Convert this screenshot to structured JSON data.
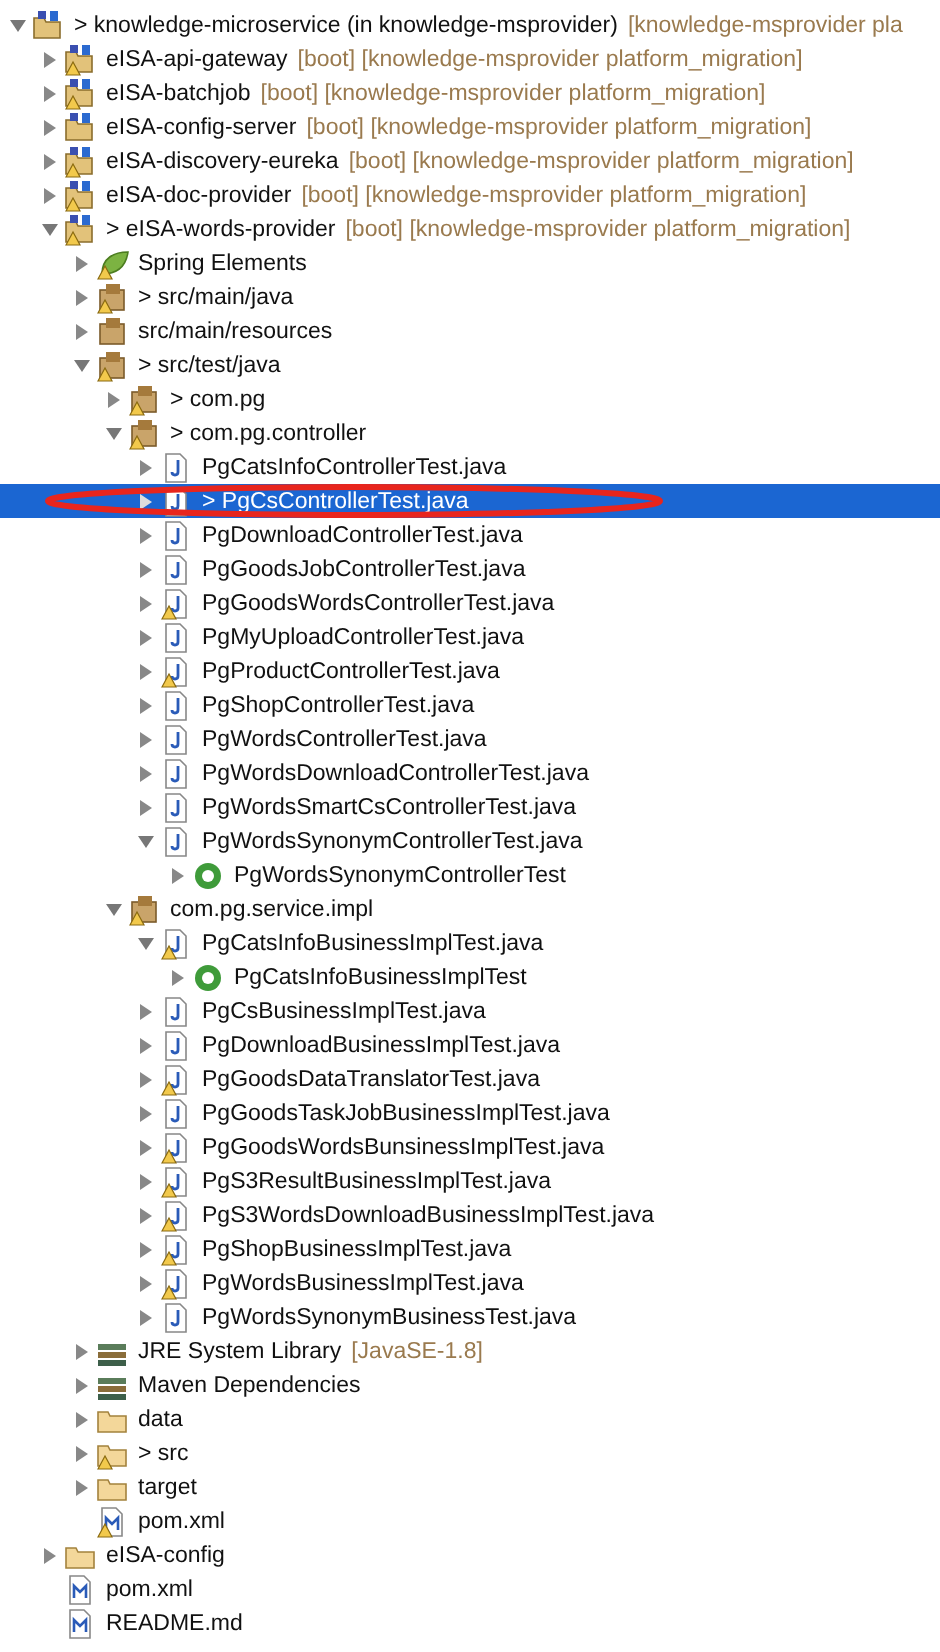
{
  "tree": [
    {
      "label": "> knowledge-microservice (in knowledge-msprovider)",
      "suffix": "[knowledge-msprovider pla",
      "kind": "working-set",
      "warning": false,
      "expandable": true,
      "expanded": true,
      "selected": false,
      "children": [
        {
          "label": "eISA-api-gateway",
          "suffix": "[boot]  [knowledge-msprovider platform_migration]",
          "kind": "project",
          "warning": true,
          "expandable": true,
          "expanded": false,
          "selected": false
        },
        {
          "label": "eISA-batchjob",
          "suffix": "[boot]  [knowledge-msprovider platform_migration]",
          "kind": "project",
          "warning": true,
          "expandable": true,
          "expanded": false,
          "selected": false
        },
        {
          "label": "eISA-config-server",
          "suffix": "[boot]  [knowledge-msprovider platform_migration]",
          "kind": "project",
          "warning": false,
          "expandable": true,
          "expanded": false,
          "selected": false
        },
        {
          "label": "eISA-discovery-eureka",
          "suffix": "[boot]  [knowledge-msprovider platform_migration]",
          "kind": "project",
          "warning": true,
          "expandable": true,
          "expanded": false,
          "selected": false
        },
        {
          "label": "eISA-doc-provider",
          "suffix": "[boot]  [knowledge-msprovider platform_migration]",
          "kind": "project",
          "warning": true,
          "expandable": true,
          "expanded": false,
          "selected": false
        },
        {
          "label": "> eISA-words-provider",
          "suffix": "[boot]  [knowledge-msprovider platform_migration]",
          "kind": "project",
          "warning": true,
          "expandable": true,
          "expanded": true,
          "selected": false,
          "children": [
            {
              "label": "Spring Elements",
              "kind": "spring",
              "warning": true,
              "expandable": true,
              "expanded": false,
              "selected": false
            },
            {
              "label": "> src/main/java",
              "kind": "source",
              "warning": true,
              "expandable": true,
              "expanded": false,
              "selected": false
            },
            {
              "label": "src/main/resources",
              "kind": "source",
              "warning": false,
              "expandable": true,
              "expanded": false,
              "selected": false
            },
            {
              "label": "> src/test/java",
              "kind": "source",
              "warning": true,
              "expandable": true,
              "expanded": true,
              "selected": false,
              "children": [
                {
                  "label": "> com.pg",
                  "kind": "package",
                  "warning": true,
                  "expandable": true,
                  "expanded": false,
                  "selected": false
                },
                {
                  "label": "> com.pg.controller",
                  "kind": "package",
                  "warning": true,
                  "expandable": true,
                  "expanded": true,
                  "selected": false,
                  "children": [
                    {
                      "label": "PgCatsInfoControllerTest.java",
                      "kind": "java",
                      "warning": false,
                      "expandable": true,
                      "expanded": false,
                      "selected": false
                    },
                    {
                      "label": "> PgCsControllerTest.java",
                      "kind": "java",
                      "warning": false,
                      "expandable": true,
                      "expanded": false,
                      "selected": true
                    },
                    {
                      "label": "PgDownloadControllerTest.java",
                      "kind": "java",
                      "warning": false,
                      "expandable": true,
                      "expanded": false,
                      "selected": false
                    },
                    {
                      "label": "PgGoodsJobControllerTest.java",
                      "kind": "java",
                      "warning": false,
                      "expandable": true,
                      "expanded": false,
                      "selected": false
                    },
                    {
                      "label": "PgGoodsWordsControllerTest.java",
                      "kind": "java",
                      "warning": true,
                      "expandable": true,
                      "expanded": false,
                      "selected": false
                    },
                    {
                      "label": "PgMyUploadControllerTest.java",
                      "kind": "java",
                      "warning": false,
                      "expandable": true,
                      "expanded": false,
                      "selected": false
                    },
                    {
                      "label": "PgProductControllerTest.java",
                      "kind": "java",
                      "warning": true,
                      "expandable": true,
                      "expanded": false,
                      "selected": false
                    },
                    {
                      "label": "PgShopControllerTest.java",
                      "kind": "java",
                      "warning": false,
                      "expandable": true,
                      "expanded": false,
                      "selected": false
                    },
                    {
                      "label": "PgWordsControllerTest.java",
                      "kind": "java",
                      "warning": false,
                      "expandable": true,
                      "expanded": false,
                      "selected": false
                    },
                    {
                      "label": "PgWordsDownloadControllerTest.java",
                      "kind": "java",
                      "warning": false,
                      "expandable": true,
                      "expanded": false,
                      "selected": false
                    },
                    {
                      "label": "PgWordsSmartCsControllerTest.java",
                      "kind": "java",
                      "warning": false,
                      "expandable": true,
                      "expanded": false,
                      "selected": false
                    },
                    {
                      "label": "PgWordsSynonymControllerTest.java",
                      "kind": "java",
                      "warning": false,
                      "expandable": true,
                      "expanded": true,
                      "selected": false,
                      "children": [
                        {
                          "label": "PgWordsSynonymControllerTest",
                          "kind": "class",
                          "warning": false,
                          "expandable": true,
                          "expanded": false,
                          "selected": false
                        }
                      ]
                    }
                  ]
                },
                {
                  "label": "com.pg.service.impl",
                  "kind": "package",
                  "warning": true,
                  "expandable": true,
                  "expanded": true,
                  "selected": false,
                  "children": [
                    {
                      "label": "PgCatsInfoBusinessImplTest.java",
                      "kind": "java",
                      "warning": true,
                      "expandable": true,
                      "expanded": true,
                      "selected": false,
                      "children": [
                        {
                          "label": "PgCatsInfoBusinessImplTest",
                          "kind": "class",
                          "warning": false,
                          "expandable": true,
                          "expanded": false,
                          "selected": false
                        }
                      ]
                    },
                    {
                      "label": "PgCsBusinessImplTest.java",
                      "kind": "java",
                      "warning": false,
                      "expandable": true,
                      "expanded": false,
                      "selected": false
                    },
                    {
                      "label": "PgDownloadBusinessImplTest.java",
                      "kind": "java",
                      "warning": false,
                      "expandable": true,
                      "expanded": false,
                      "selected": false
                    },
                    {
                      "label": "PgGoodsDataTranslatorTest.java",
                      "kind": "java",
                      "warning": true,
                      "expandable": true,
                      "expanded": false,
                      "selected": false
                    },
                    {
                      "label": "PgGoodsTaskJobBusinessImplTest.java",
                      "kind": "java",
                      "warning": false,
                      "expandable": true,
                      "expanded": false,
                      "selected": false
                    },
                    {
                      "label": "PgGoodsWordsBunsinessImplTest.java",
                      "kind": "java",
                      "warning": true,
                      "expandable": true,
                      "expanded": false,
                      "selected": false
                    },
                    {
                      "label": "PgS3ResultBusinessImplTest.java",
                      "kind": "java",
                      "warning": true,
                      "expandable": true,
                      "expanded": false,
                      "selected": false
                    },
                    {
                      "label": "PgS3WordsDownloadBusinessImplTest.java",
                      "kind": "java",
                      "warning": true,
                      "expandable": true,
                      "expanded": false,
                      "selected": false
                    },
                    {
                      "label": "PgShopBusinessImplTest.java",
                      "kind": "java",
                      "warning": true,
                      "expandable": true,
                      "expanded": false,
                      "selected": false
                    },
                    {
                      "label": "PgWordsBusinessImplTest.java",
                      "kind": "java",
                      "warning": true,
                      "expandable": true,
                      "expanded": false,
                      "selected": false
                    },
                    {
                      "label": "PgWordsSynonymBusinessTest.java",
                      "kind": "java",
                      "warning": false,
                      "expandable": true,
                      "expanded": false,
                      "selected": false
                    }
                  ]
                }
              ]
            },
            {
              "label": "JRE System Library",
              "suffix": "[JavaSE-1.8]",
              "kind": "library",
              "warning": false,
              "expandable": true,
              "expanded": false,
              "selected": false
            },
            {
              "label": "Maven Dependencies",
              "kind": "library",
              "warning": false,
              "expandable": true,
              "expanded": false,
              "selected": false
            },
            {
              "label": "data",
              "kind": "folder",
              "warning": false,
              "expandable": true,
              "expanded": false,
              "selected": false
            },
            {
              "label": "> src",
              "kind": "folder",
              "warning": true,
              "expandable": true,
              "expanded": false,
              "selected": false
            },
            {
              "label": "target",
              "kind": "folder",
              "warning": false,
              "expandable": true,
              "expanded": false,
              "selected": false
            },
            {
              "label": "pom.xml",
              "kind": "xml",
              "warning": true,
              "expandable": false,
              "selected": false
            }
          ]
        },
        {
          "label": "eISA-config",
          "kind": "folder",
          "warning": false,
          "expandable": true,
          "expanded": false,
          "selected": false
        },
        {
          "label": "pom.xml",
          "kind": "xml",
          "warning": false,
          "expandable": false,
          "selected": false
        },
        {
          "label": "README.md",
          "kind": "xml",
          "warning": false,
          "expandable": false,
          "selected": false
        }
      ]
    }
  ]
}
